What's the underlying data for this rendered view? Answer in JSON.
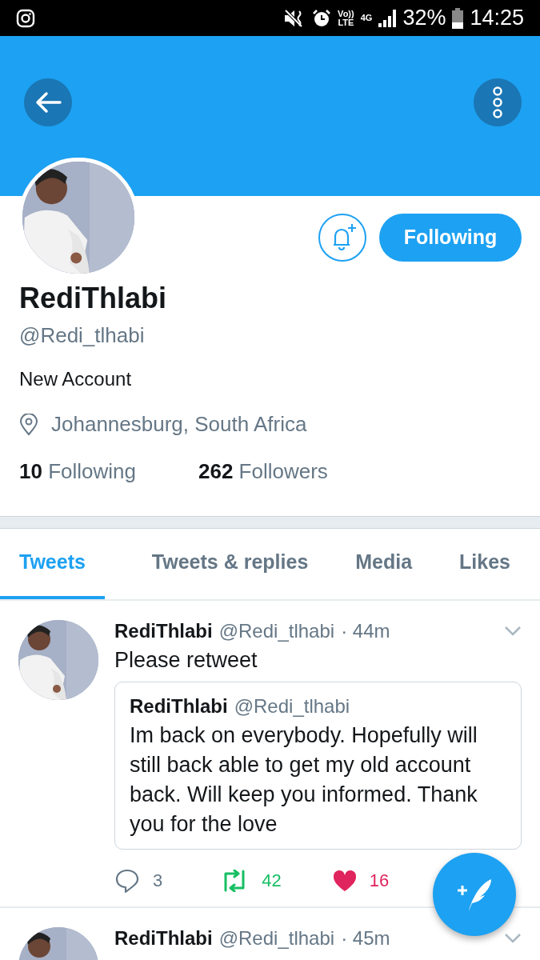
{
  "status_bar": {
    "volte_top": "Vo))",
    "volte_bottom": "LTE",
    "network": "4G",
    "battery": "32%",
    "time": "14:25"
  },
  "profile": {
    "name": "RediThlabi",
    "handle": "@Redi_tlhabi",
    "bio": "New Account",
    "location": "Johannesburg, South Africa",
    "following_count": "10",
    "following_label": "Following",
    "followers_count": "262",
    "followers_label": "Followers",
    "follow_button": "Following"
  },
  "tabs": [
    {
      "label": "Tweets",
      "selected": true
    },
    {
      "label": "Tweets & replies",
      "selected": false
    },
    {
      "label": "Media",
      "selected": false
    },
    {
      "label": "Likes",
      "selected": false
    }
  ],
  "tweets": [
    {
      "name": "RediThlabi",
      "handle": "@Redi_tlhabi",
      "time": "· 44m",
      "text": "Please retweet",
      "quote": {
        "name": "RediThlabi",
        "handle": "@Redi_tlhabi",
        "text": "Im back on everybody. Hopefully will still back able to get my old account back. Will keep you informed. Thank you for the love"
      },
      "replies": "3",
      "retweets": "42",
      "likes": "16",
      "retweeted": true,
      "liked": true
    },
    {
      "name": "RediThlabi",
      "handle": "@Redi_tlhabi",
      "time": "· 45m"
    }
  ]
}
